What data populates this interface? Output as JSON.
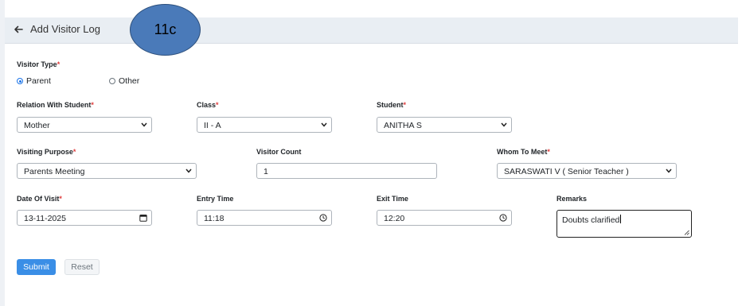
{
  "header": {
    "title": "Add Visitor Log",
    "annotation": "11c"
  },
  "form": {
    "visitor_type": {
      "label": "Visitor Type",
      "options": [
        "Parent",
        "Other"
      ],
      "selected": "Parent"
    },
    "relation": {
      "label": "Relation With Student",
      "value": "Mother"
    },
    "class": {
      "label": "Class",
      "value": "II - A"
    },
    "student": {
      "label": "Student",
      "value": "ANITHA S"
    },
    "purpose": {
      "label": "Visiting Purpose",
      "value": "Parents Meeting"
    },
    "count": {
      "label": "Visitor Count",
      "value": "1"
    },
    "meet": {
      "label": "Whom To Meet",
      "value": "SARASWATI V ( Senior Teacher )"
    },
    "date": {
      "label": "Date Of Visit",
      "value": "13-11-2025"
    },
    "entry": {
      "label": "Entry Time",
      "value": "11:18"
    },
    "exit": {
      "label": "Exit Time",
      "value": "12:20"
    },
    "remarks": {
      "label": "Remarks",
      "value": "Doubts clarified"
    },
    "required_mark": "*"
  },
  "buttons": {
    "submit": "Submit",
    "reset": "Reset"
  },
  "colors": {
    "primary": "#3a8ee6",
    "required": "#e03e3e",
    "annotation_fill": "#4a7ab9"
  },
  "icons": [
    "back-arrow-icon",
    "chevron-down-icon",
    "calendar-icon",
    "clock-icon",
    "resize-grip-icon"
  ]
}
